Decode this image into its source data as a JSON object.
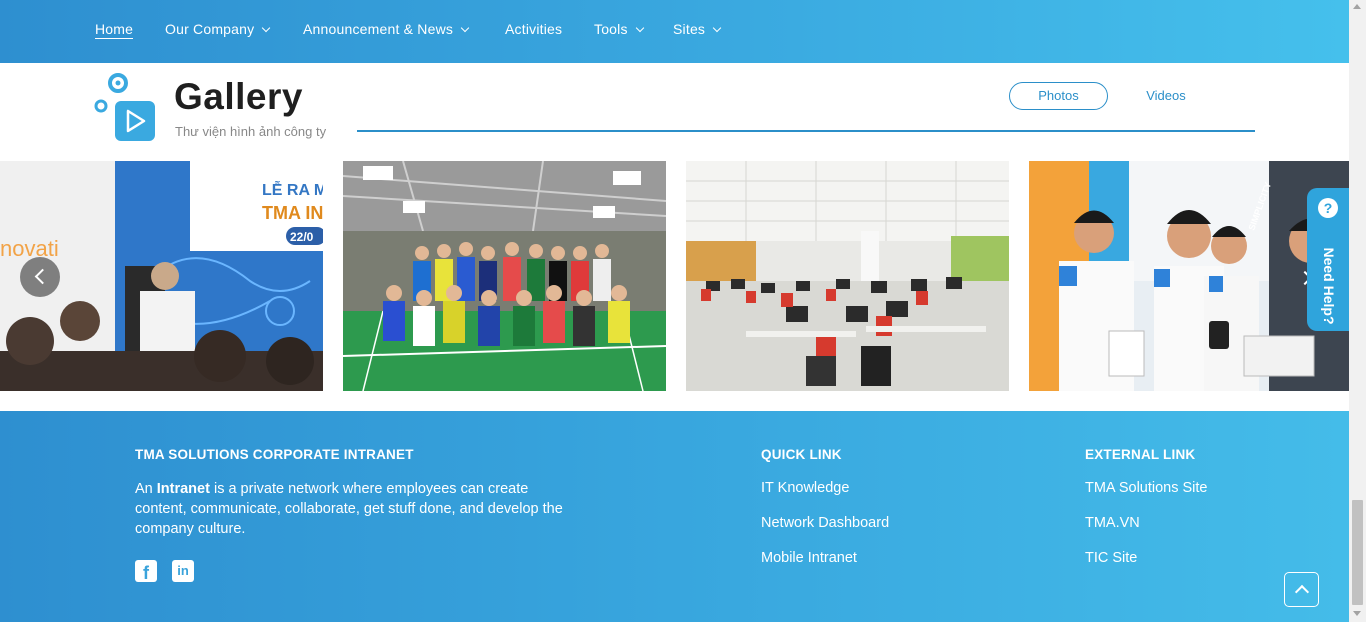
{
  "nav": {
    "items": [
      {
        "label": "Home",
        "active": true,
        "dropdown": false
      },
      {
        "label": "Our Company",
        "dropdown": true
      },
      {
        "label": "Announcement & News",
        "dropdown": true
      },
      {
        "label": "Activities",
        "dropdown": false
      },
      {
        "label": "Tools",
        "dropdown": true
      },
      {
        "label": "Sites",
        "dropdown": true
      }
    ]
  },
  "gallery": {
    "title": "Gallery",
    "subtitle": "Thư viện hình ảnh công ty",
    "tabs": {
      "photos": "Photos",
      "videos": "Videos"
    },
    "slides": [
      {
        "icon": "event-photo",
        "caption_fragments": [
          "LỄ RA MẮ",
          "TMA IN",
          "22/0",
          "novati"
        ]
      },
      {
        "icon": "badminton-team-photo"
      },
      {
        "icon": "office-photo"
      },
      {
        "icon": "team-demo-photo",
        "caption_fragments": [
          "SIMPLICITY"
        ]
      }
    ]
  },
  "help": {
    "label": "Need Help?",
    "icon": "question-icon"
  },
  "footer": {
    "about": {
      "heading": "TMA SOLUTIONS CORPORATE INTRANET",
      "text_prefix": "An ",
      "text_bold": "Intranet",
      "text_rest": " is a private network where employees can create content, communicate, collaborate, get stuff done, and develop the company culture."
    },
    "quick_link": {
      "heading": "QUICK LINK",
      "links": [
        "IT Knowledge",
        "Network Dashboard",
        "Mobile Intranet"
      ]
    },
    "external_link": {
      "heading": "EXTERNAL LINK",
      "links": [
        "TMA Solutions Site",
        "TMA.VN",
        "TIC Site"
      ]
    },
    "social": [
      {
        "icon": "facebook-icon",
        "glyph": "f"
      },
      {
        "icon": "linkedin-icon",
        "glyph": "in"
      }
    ]
  },
  "colors": {
    "accent": "#2b8fc9",
    "nav_gradient_start": "#2e8fd0",
    "nav_gradient_end": "#45c0ec",
    "help_bg": "#2fa4dc"
  }
}
